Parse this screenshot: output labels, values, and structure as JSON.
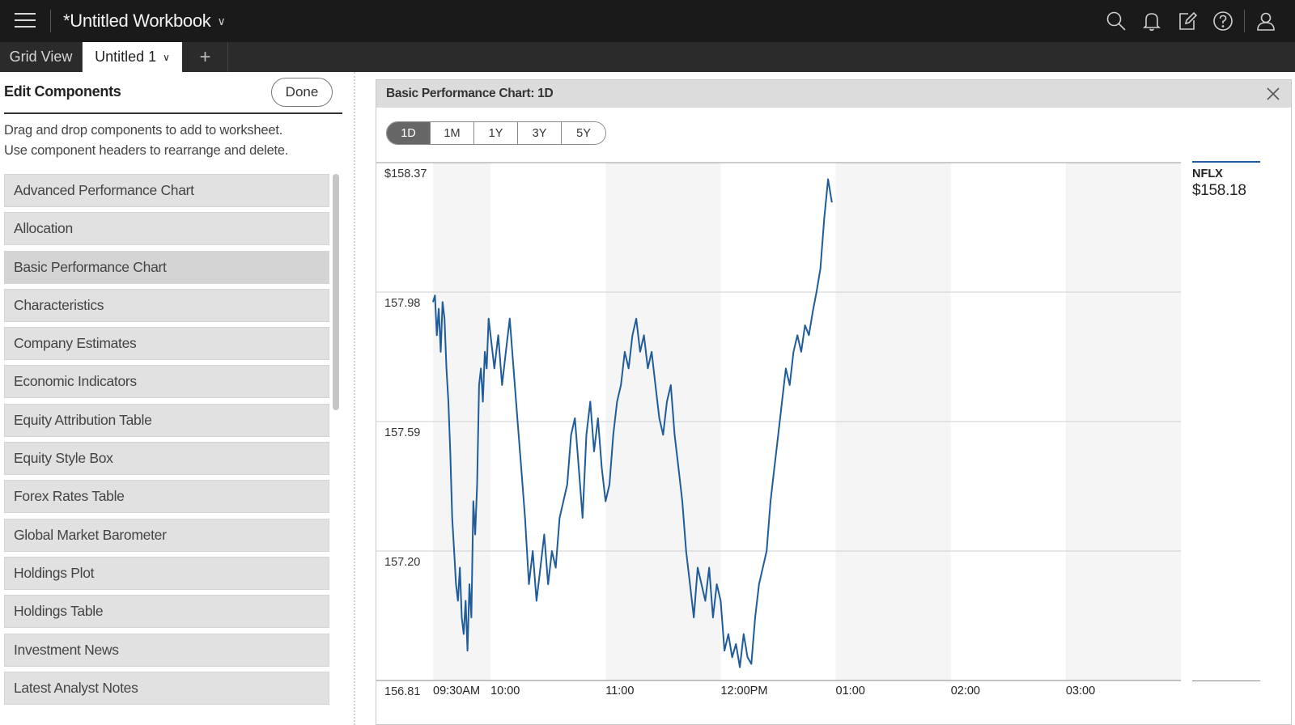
{
  "app": {
    "workbook_title": "*Untitled Workbook",
    "icons": [
      "menu-icon",
      "search-icon",
      "bell-icon",
      "edit-icon",
      "help-icon",
      "user-icon"
    ]
  },
  "tabs": {
    "grid_view": "Grid View",
    "active": "Untitled 1",
    "add": "+"
  },
  "left_panel": {
    "title": "Edit Components",
    "done_label": "Done",
    "help_line1": "Drag and drop components to add to worksheet.",
    "help_line2": "Use component headers to rearrange and delete.",
    "items": [
      "Advanced Performance Chart",
      "Allocation",
      "Basic Performance Chart",
      "Characteristics",
      "Company Estimates",
      "Economic Indicators",
      "Equity Attribution Table",
      "Equity Style Box",
      "Forex Rates Table",
      "Global Market Barometer",
      "Holdings Plot",
      "Holdings Table",
      "Investment News",
      "Latest Analyst Notes"
    ],
    "highlighted_item": "Basic Performance Chart"
  },
  "chart_panel": {
    "title": "Basic Performance Chart: 1D",
    "ranges": [
      "1D",
      "1M",
      "1Y",
      "3Y",
      "5Y"
    ],
    "selected_range": "1D"
  },
  "chart_data": {
    "type": "line",
    "line_color": "#1f5c99",
    "x_ticks": [
      "09:30AM",
      "10:00",
      "11:00",
      "12:00PM",
      "01:00",
      "02:00",
      "03:00"
    ],
    "x_tick_minutes": [
      0,
      30,
      90,
      150,
      210,
      270,
      330
    ],
    "x_range_minutes": [
      0,
      390
    ],
    "y_ticks": [
      "$158.37",
      "157.98",
      "157.59",
      "157.20",
      "156.81"
    ],
    "y_tick_values": [
      158.37,
      157.98,
      157.59,
      157.2,
      156.81
    ],
    "ylim": [
      156.81,
      158.37
    ],
    "grid": true,
    "legend_position": "right",
    "series": [
      {
        "name": "NFLX",
        "last_value": "$158.18",
        "x_minutes": [
          0,
          1,
          2,
          3,
          4,
          5,
          6,
          7,
          8,
          9,
          10,
          11,
          12,
          13,
          14,
          15,
          16,
          17,
          18,
          19,
          20,
          21,
          22,
          23,
          24,
          25,
          26,
          27,
          28,
          29,
          30,
          32,
          34,
          36,
          38,
          40,
          42,
          44,
          46,
          48,
          50,
          52,
          54,
          56,
          58,
          60,
          62,
          64,
          66,
          68,
          70,
          72,
          74,
          76,
          78,
          80,
          82,
          84,
          86,
          88,
          90,
          92,
          94,
          96,
          98,
          100,
          102,
          104,
          106,
          108,
          110,
          112,
          114,
          116,
          118,
          120,
          122,
          124,
          126,
          128,
          130,
          132,
          134,
          136,
          138,
          140,
          142,
          144,
          146,
          148,
          150,
          152,
          154,
          156,
          158,
          160,
          162,
          164,
          166,
          168,
          170,
          172,
          174,
          176,
          178,
          180,
          182,
          184,
          186,
          188,
          190,
          192,
          194,
          196,
          198,
          200,
          202,
          204,
          206,
          208,
          210,
          212,
          214,
          216,
          218,
          220,
          222,
          224,
          226,
          228,
          230,
          232,
          234,
          236,
          238,
          240,
          242,
          244,
          246,
          248,
          250,
          252,
          254,
          256,
          258,
          260,
          262,
          264,
          266,
          268,
          270,
          272,
          274,
          276,
          278,
          280,
          282,
          284,
          286,
          288
        ],
        "values": [
          157.95,
          157.97,
          157.85,
          157.93,
          157.8,
          157.95,
          157.9,
          157.75,
          157.65,
          157.5,
          157.3,
          157.2,
          157.1,
          157.05,
          157.15,
          157.0,
          156.95,
          157.05,
          156.9,
          157.1,
          157.0,
          157.35,
          157.25,
          157.4,
          157.7,
          157.75,
          157.65,
          157.8,
          157.75,
          157.9,
          157.85,
          157.75,
          157.85,
          157.7,
          157.8,
          157.9,
          157.75,
          157.6,
          157.45,
          157.3,
          157.1,
          157.2,
          157.05,
          157.15,
          157.25,
          157.1,
          157.2,
          157.15,
          157.3,
          157.35,
          157.4,
          157.55,
          157.6,
          157.45,
          157.3,
          157.55,
          157.65,
          157.5,
          157.6,
          157.45,
          157.35,
          157.4,
          157.55,
          157.65,
          157.7,
          157.8,
          157.75,
          157.85,
          157.9,
          157.8,
          157.85,
          157.75,
          157.8,
          157.7,
          157.6,
          157.55,
          157.65,
          157.7,
          157.55,
          157.45,
          157.35,
          157.2,
          157.1,
          157.0,
          157.15,
          157.1,
          157.05,
          157.15,
          157.0,
          157.1,
          157.05,
          156.9,
          156.95,
          156.88,
          156.92,
          156.85,
          156.95,
          156.88,
          156.86,
          157.0,
          157.1,
          157.15,
          157.2,
          157.35,
          157.45,
          157.55,
          157.65,
          157.75,
          157.7,
          157.8,
          157.85,
          157.8,
          157.88,
          157.85,
          157.92,
          157.98,
          158.05,
          158.2,
          158.32,
          158.25
        ]
      }
    ]
  }
}
